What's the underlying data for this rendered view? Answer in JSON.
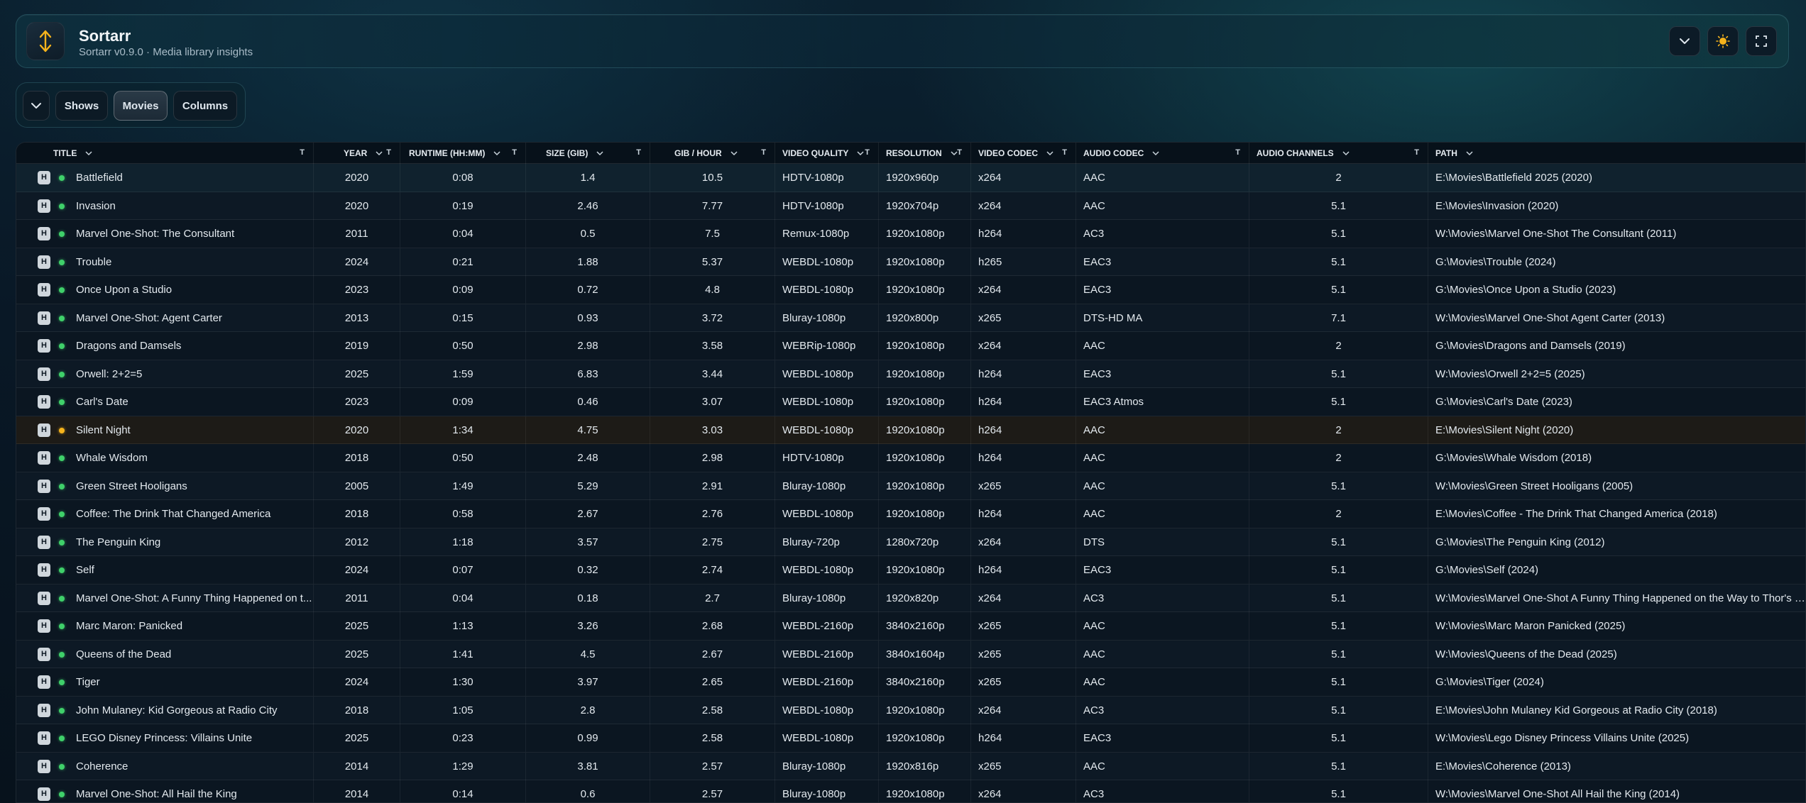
{
  "app": {
    "title": "Sortarr",
    "subtitle": "Sortarr v0.9.0 · Media library insights"
  },
  "colors": {
    "accent": "#f5b31c",
    "ok": "#3fd06a",
    "warn": "#f5b31c"
  },
  "toolbar": {
    "collapse_icon": "chevron-down-icon",
    "shows_label": "Shows",
    "movies_label": "Movies",
    "columns_label": "Columns",
    "active_tab": "Movies"
  },
  "header_buttons": [
    "chevron-down-icon",
    "sun-icon",
    "fullscreen-icon"
  ],
  "table": {
    "columns": [
      "Title",
      "Year",
      "Runtime (hh:mm)",
      "Size (GiB)",
      "GiB / hour",
      "Video Quality",
      "Resolution",
      "Video Codec",
      "Audio Codec",
      "Audio Channels",
      "Path"
    ],
    "badge_label": "H",
    "rows": [
      [
        "Battlefield",
        "2020",
        "0:08",
        "1.4",
        "10.5",
        "HDTV-1080p",
        "1920x960p",
        "x264",
        "AAC",
        "2",
        "E:\\Movies\\Battlefield 2025 (2020)"
      ],
      [
        "Invasion",
        "2020",
        "0:19",
        "2.46",
        "7.77",
        "HDTV-1080p",
        "1920x704p",
        "x264",
        "AAC",
        "5.1",
        "E:\\Movies\\Invasion (2020)"
      ],
      [
        "Marvel One-Shot: The Consultant",
        "2011",
        "0:04",
        "0.5",
        "7.5",
        "Remux-1080p",
        "1920x1080p",
        "h264",
        "AC3",
        "5.1",
        "W:\\Movies\\Marvel One-Shot The Consultant (2011)"
      ],
      [
        "Trouble",
        "2024",
        "0:21",
        "1.88",
        "5.37",
        "WEBDL-1080p",
        "1920x1080p",
        "h265",
        "EAC3",
        "5.1",
        "G:\\Movies\\Trouble (2024)"
      ],
      [
        "Once Upon a Studio",
        "2023",
        "0:09",
        "0.72",
        "4.8",
        "WEBDL-1080p",
        "1920x1080p",
        "x264",
        "EAC3",
        "5.1",
        "G:\\Movies\\Once Upon a Studio (2023)"
      ],
      [
        "Marvel One-Shot: Agent Carter",
        "2013",
        "0:15",
        "0.93",
        "3.72",
        "Bluray-1080p",
        "1920x800p",
        "x265",
        "DTS-HD MA",
        "7.1",
        "W:\\Movies\\Marvel One-Shot Agent Carter (2013)"
      ],
      [
        "Dragons and Damsels",
        "2019",
        "0:50",
        "2.98",
        "3.58",
        "WEBRip-1080p",
        "1920x1080p",
        "x264",
        "AAC",
        "2",
        "G:\\Movies\\Dragons and Damsels (2019)"
      ],
      [
        "Orwell: 2+2=5",
        "2025",
        "1:59",
        "6.83",
        "3.44",
        "WEBDL-1080p",
        "1920x1080p",
        "h264",
        "EAC3",
        "5.1",
        "W:\\Movies\\Orwell 2+2=5 (2025)"
      ],
      [
        "Carl's Date",
        "2023",
        "0:09",
        "0.46",
        "3.07",
        "WEBDL-1080p",
        "1920x1080p",
        "h264",
        "EAC3 Atmos",
        "5.1",
        "G:\\Movies\\Carl's Date (2023)"
      ],
      [
        "Silent Night",
        "2020",
        "1:34",
        "4.75",
        "3.03",
        "WEBDL-1080p",
        "1920x1080p",
        "h264",
        "AAC",
        "2",
        "E:\\Movies\\Silent Night (2020)"
      ],
      [
        "Whale Wisdom",
        "2018",
        "0:50",
        "2.48",
        "2.98",
        "HDTV-1080p",
        "1920x1080p",
        "h264",
        "AAC",
        "2",
        "G:\\Movies\\Whale Wisdom (2018)"
      ],
      [
        "Green Street Hooligans",
        "2005",
        "1:49",
        "5.29",
        "2.91",
        "Bluray-1080p",
        "1920x1080p",
        "x265",
        "AAC",
        "5.1",
        "W:\\Movies\\Green Street Hooligans (2005)"
      ],
      [
        "Coffee: The Drink That Changed America",
        "2018",
        "0:58",
        "2.67",
        "2.76",
        "WEBDL-1080p",
        "1920x1080p",
        "h264",
        "AAC",
        "2",
        "E:\\Movies\\Coffee - The Drink That Changed America (2018)"
      ],
      [
        "The Penguin King",
        "2012",
        "1:18",
        "3.57",
        "2.75",
        "Bluray-720p",
        "1280x720p",
        "x264",
        "DTS",
        "5.1",
        "G:\\Movies\\The Penguin King (2012)"
      ],
      [
        "Self",
        "2024",
        "0:07",
        "0.32",
        "2.74",
        "WEBDL-1080p",
        "1920x1080p",
        "h264",
        "EAC3",
        "5.1",
        "G:\\Movies\\Self (2024)"
      ],
      [
        "Marvel One-Shot: A Funny Thing Happened on t...",
        "2011",
        "0:04",
        "0.18",
        "2.7",
        "Bluray-1080p",
        "1920x820p",
        "x264",
        "AC3",
        "5.1",
        "W:\\Movies\\Marvel One-Shot A Funny Thing Happened on the Way to Thor's Ha"
      ],
      [
        "Marc Maron: Panicked",
        "2025",
        "1:13",
        "3.26",
        "2.68",
        "WEBDL-2160p",
        "3840x2160p",
        "x265",
        "AAC",
        "5.1",
        "W:\\Movies\\Marc Maron Panicked (2025)"
      ],
      [
        "Queens of the Dead",
        "2025",
        "1:41",
        "4.5",
        "2.67",
        "WEBDL-2160p",
        "3840x1604p",
        "x265",
        "AAC",
        "5.1",
        "W:\\Movies\\Queens of the Dead (2025)"
      ],
      [
        "Tiger",
        "2024",
        "1:30",
        "3.97",
        "2.65",
        "WEBDL-2160p",
        "3840x2160p",
        "x265",
        "AAC",
        "5.1",
        "G:\\Movies\\Tiger (2024)"
      ],
      [
        "John Mulaney: Kid Gorgeous at Radio City",
        "2018",
        "1:05",
        "2.8",
        "2.58",
        "WEBDL-1080p",
        "1920x1080p",
        "x264",
        "AC3",
        "5.1",
        "E:\\Movies\\John Mulaney Kid Gorgeous at Radio City (2018)"
      ],
      [
        "LEGO Disney Princess: Villains Unite",
        "2025",
        "0:23",
        "0.99",
        "2.58",
        "WEBDL-1080p",
        "1920x1080p",
        "h264",
        "EAC3",
        "5.1",
        "W:\\Movies\\Lego Disney Princess Villains Unite (2025)"
      ],
      [
        "Coherence",
        "2014",
        "1:29",
        "3.81",
        "2.57",
        "Bluray-1080p",
        "1920x816p",
        "x265",
        "AAC",
        "5.1",
        "E:\\Movies\\Coherence (2013)"
      ],
      [
        "Marvel One-Shot: All Hail the King",
        "2014",
        "0:14",
        "0.6",
        "2.57",
        "Bluray-1080p",
        "1920x1080p",
        "x264",
        "AC3",
        "5.1",
        "W:\\Movies\\Marvel One-Shot All Hail the King (2014)"
      ]
    ],
    "row_status": [
      "ok",
      "ok",
      "ok",
      "ok",
      "ok",
      "ok",
      "ok",
      "ok",
      "ok",
      "warn",
      "ok",
      "ok",
      "ok",
      "ok",
      "ok",
      "ok",
      "ok",
      "ok",
      "ok",
      "ok",
      "ok",
      "ok",
      "ok"
    ]
  }
}
